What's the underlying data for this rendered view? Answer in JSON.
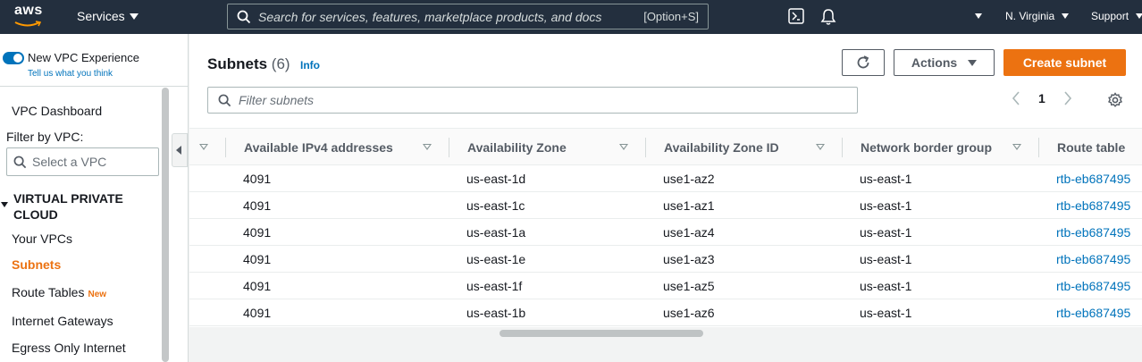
{
  "topnav": {
    "logo_text": "aws",
    "services_label": "Services",
    "search_placeholder": "Search for services, features, marketplace products, and docs",
    "search_shortcut": "[Option+S]",
    "region": "N. Virginia",
    "support": "Support"
  },
  "sidebar": {
    "new_experience_label": "New VPC Experience",
    "tell_us": "Tell us what you think",
    "dashboard": "VPC Dashboard",
    "filter_label": "Filter by VPC:",
    "select_placeholder": "Select a VPC",
    "section_title": "VIRTUAL PRIVATE CLOUD",
    "items": [
      {
        "label": "Your VPCs",
        "active": false,
        "badge": ""
      },
      {
        "label": "Subnets",
        "active": true,
        "badge": ""
      },
      {
        "label": "Route Tables",
        "active": false,
        "badge": "New"
      },
      {
        "label": "Internet Gateways",
        "active": false,
        "badge": ""
      },
      {
        "label": "Egress Only Internet",
        "active": false,
        "badge": ""
      }
    ]
  },
  "main": {
    "title": "Subnets",
    "count": "(6)",
    "info": "Info",
    "actions_label": "Actions",
    "create_label": "Create subnet",
    "filter_placeholder": "Filter subnets",
    "page": "1",
    "columns": [
      "Available IPv4 addresses",
      "Availability Zone",
      "Availability Zone ID",
      "Network border group",
      "Route table"
    ],
    "rows": [
      [
        "4091",
        "us-east-1d",
        "use1-az2",
        "us-east-1",
        "rtb-eb687495"
      ],
      [
        "4091",
        "us-east-1c",
        "use1-az1",
        "us-east-1",
        "rtb-eb687495"
      ],
      [
        "4091",
        "us-east-1a",
        "use1-az4",
        "us-east-1",
        "rtb-eb687495"
      ],
      [
        "4091",
        "us-east-1e",
        "use1-az3",
        "us-east-1",
        "rtb-eb687495"
      ],
      [
        "4091",
        "us-east-1f",
        "use1-az5",
        "us-east-1",
        "rtb-eb687495"
      ],
      [
        "4091",
        "us-east-1b",
        "use1-az6",
        "us-east-1",
        "rtb-eb687495"
      ]
    ]
  },
  "colors": {
    "nav_bg": "#232f3e",
    "accent": "#ec7211",
    "link": "#0073bb"
  },
  "icons": [
    "aws-logo-icon",
    "search-icon",
    "cloudshell-icon",
    "bell-icon",
    "refresh-icon",
    "filter-search-icon",
    "chevron-left-icon",
    "chevron-right-icon",
    "settings-gear-icon",
    "sort-icon",
    "collapse-sidebar-icon"
  ]
}
